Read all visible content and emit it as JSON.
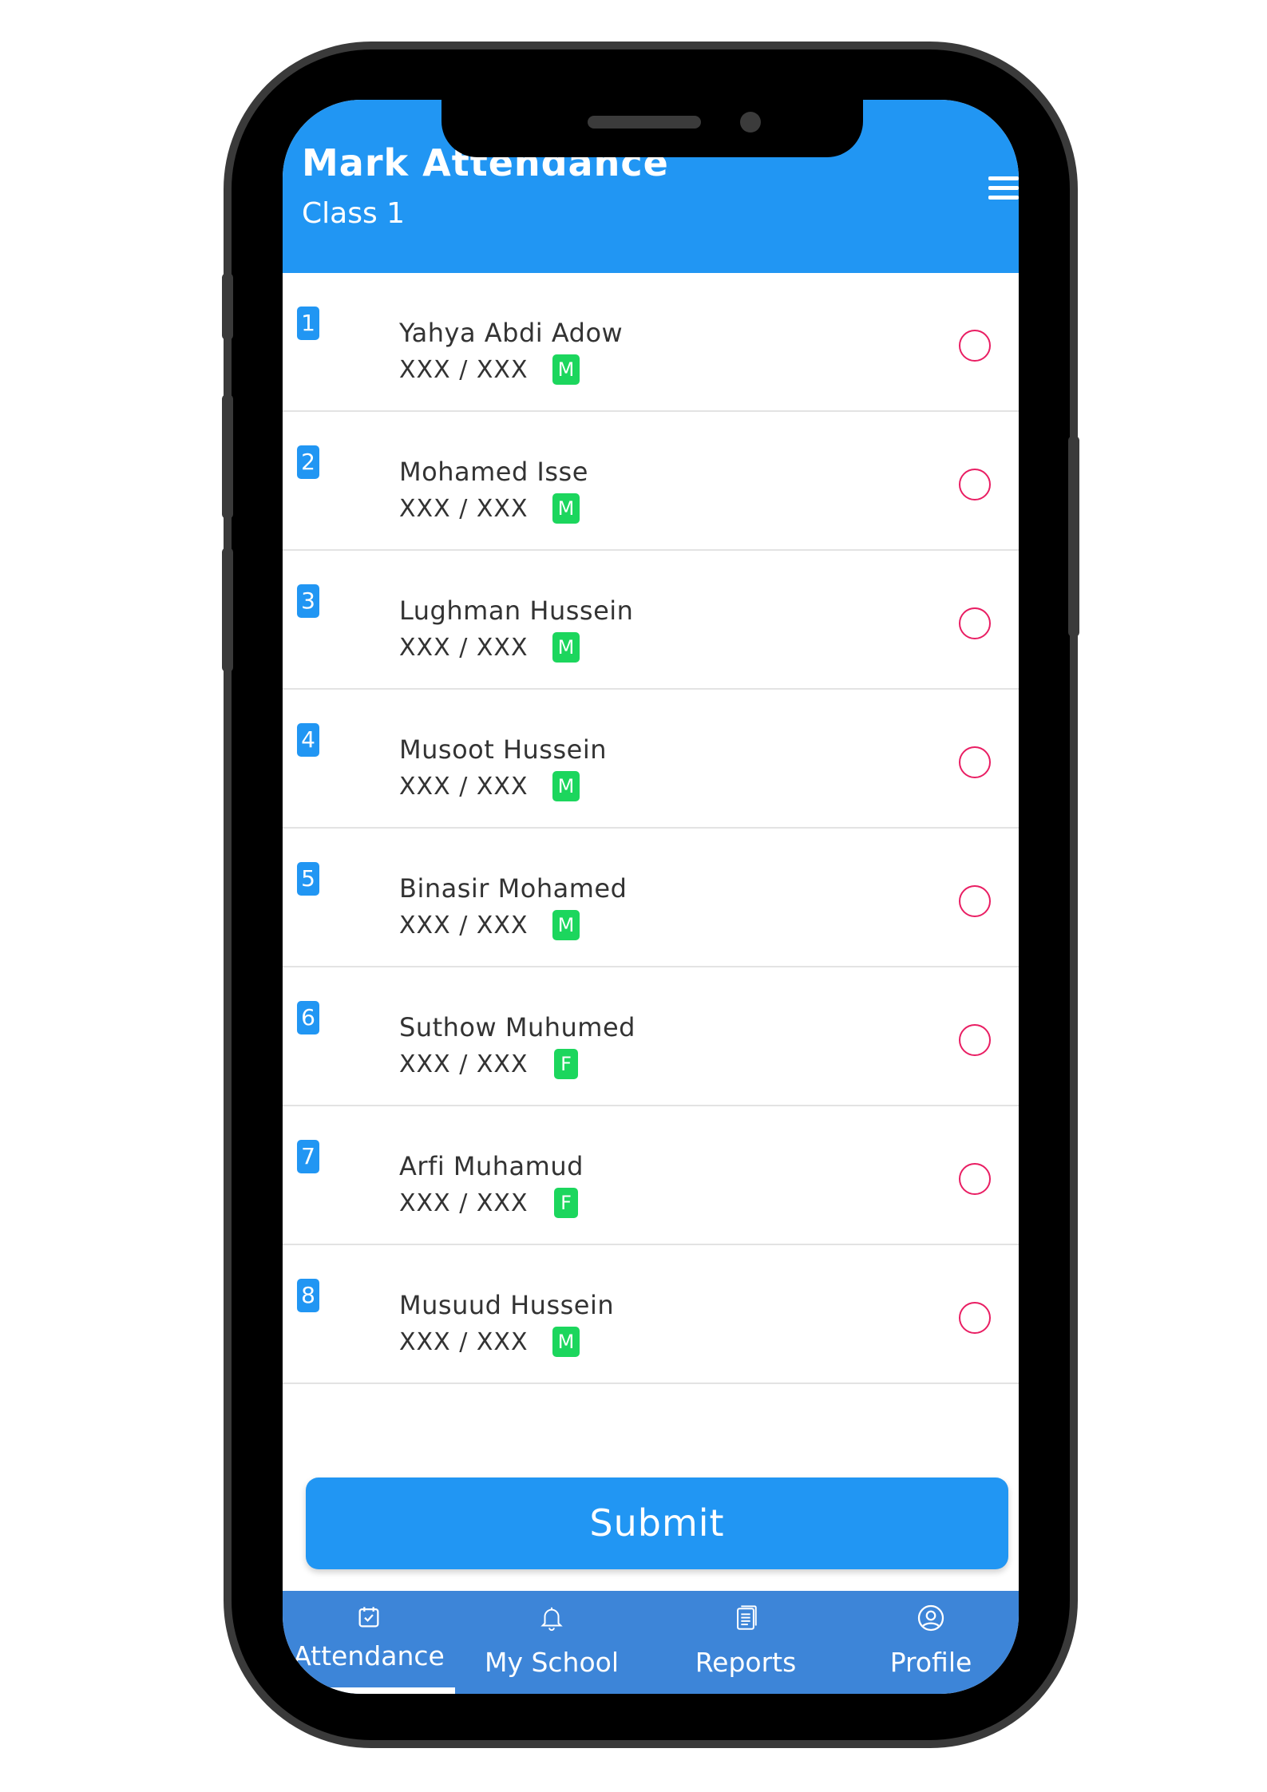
{
  "header": {
    "title": "Mark Attendance",
    "subtitle": "Class 1"
  },
  "students": [
    {
      "num": "1",
      "name": "Yahya Abdi Adow",
      "id": "XXX / XXX",
      "gender": "M"
    },
    {
      "num": "2",
      "name": "Mohamed Isse",
      "id": "XXX / XXX",
      "gender": "M"
    },
    {
      "num": "3",
      "name": "Lughman Hussein",
      "id": "XXX / XXX",
      "gender": "M"
    },
    {
      "num": "4",
      "name": "Musoot Hussein",
      "id": "XXX / XXX",
      "gender": "M"
    },
    {
      "num": "5",
      "name": "Binasir Mohamed",
      "id": "XXX / XXX",
      "gender": "M"
    },
    {
      "num": "6",
      "name": "Suthow Muhumed",
      "id": "XXX / XXX",
      "gender": "F"
    },
    {
      "num": "7",
      "name": "Arfi Muhamud",
      "id": "XXX / XXX",
      "gender": "F"
    },
    {
      "num": "8",
      "name": "Musuud Hussein",
      "id": "XXX / XXX",
      "gender": "M"
    }
  ],
  "submit_label": "Submit",
  "nav": [
    {
      "label": "Attendance",
      "icon": "calendar-check-icon",
      "active": true
    },
    {
      "label": "My School",
      "icon": "bell-icon",
      "active": false
    },
    {
      "label": "Reports",
      "icon": "document-icon",
      "active": false
    },
    {
      "label": "Profile",
      "icon": "user-circle-icon",
      "active": false
    }
  ],
  "colors": {
    "primary": "#2196F3",
    "nav": "#3d85d8",
    "badge": "#1cd65d",
    "radio": "#e91e63"
  }
}
